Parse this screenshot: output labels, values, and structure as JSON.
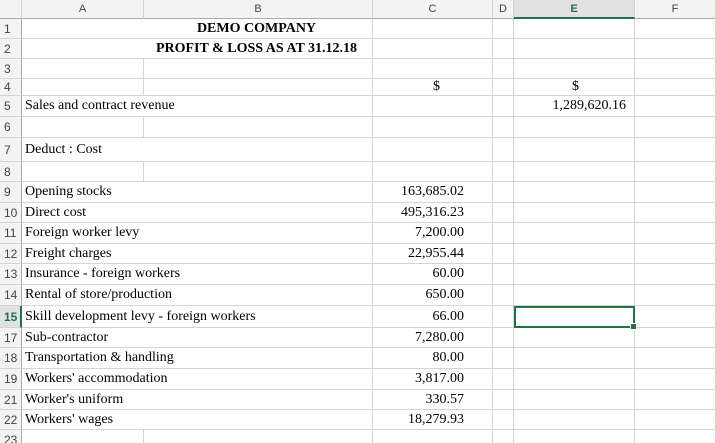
{
  "columns": [
    "A",
    "B",
    "C",
    "D",
    "E",
    "F"
  ],
  "active_column": "E",
  "active_row": "15",
  "rows": [
    {
      "n": "1",
      "b": "DEMO COMPANY",
      "c": "",
      "e": "",
      "style": "title"
    },
    {
      "n": "2",
      "b": "PROFIT & LOSS AS AT 31.12.18",
      "c": "",
      "e": "",
      "style": "title"
    },
    {
      "n": "3",
      "b": "",
      "c": "",
      "e": ""
    },
    {
      "n": "4",
      "b": "",
      "c": "$",
      "e": "$",
      "style": "currency"
    },
    {
      "n": "5",
      "b": "Sales and contract revenue",
      "c": "",
      "e": "1,289,620.16"
    },
    {
      "n": "6",
      "b": "",
      "c": "",
      "e": ""
    },
    {
      "n": "7",
      "b": "Deduct : Cost",
      "c": "",
      "e": "",
      "style": "tall"
    },
    {
      "n": "8",
      "b": "",
      "c": "",
      "e": ""
    },
    {
      "n": "9",
      "b": "Opening stocks",
      "c": "163,685.02",
      "e": ""
    },
    {
      "n": "10",
      "b": "Direct cost",
      "c": "495,316.23",
      "e": ""
    },
    {
      "n": "11",
      "b": "Foreign worker levy",
      "c": "7,200.00",
      "e": ""
    },
    {
      "n": "12",
      "b": "Freight charges",
      "c": "22,955.44",
      "e": ""
    },
    {
      "n": "13",
      "b": "Insurance - foreign workers",
      "c": "60.00",
      "e": ""
    },
    {
      "n": "14",
      "b": "Rental of store/production",
      "c": "650.00",
      "e": ""
    },
    {
      "n": "15",
      "b": "Skill development levy - foreign workers",
      "c": "66.00",
      "e": ""
    },
    {
      "n": "17",
      "b": "Sub-contractor",
      "c": "7,280.00",
      "e": ""
    },
    {
      "n": "18",
      "b": "Transportation & handling",
      "c": "80.00",
      "e": ""
    },
    {
      "n": "19",
      "b": "Workers' accommodation",
      "c": "3,817.00",
      "e": ""
    },
    {
      "n": "21",
      "b": "Worker's uniform",
      "c": "330.57",
      "e": ""
    },
    {
      "n": "22",
      "b": "Workers' wages",
      "c": "18,279.93",
      "e": ""
    },
    {
      "n": "23",
      "b": "",
      "c": "",
      "e": ""
    }
  ]
}
